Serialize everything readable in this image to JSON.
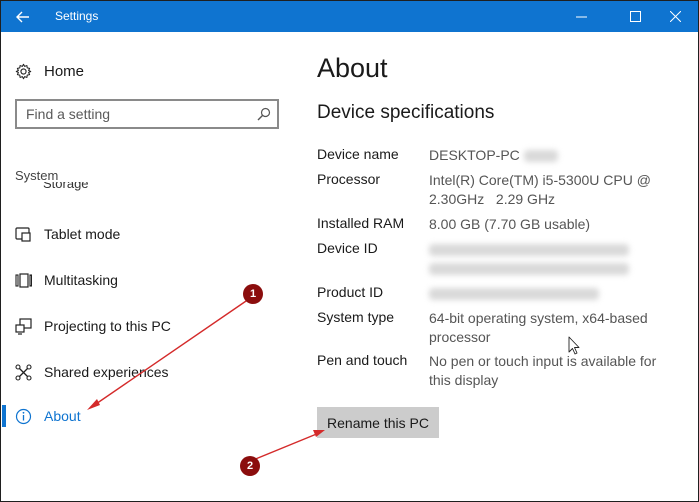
{
  "window": {
    "title": "Settings",
    "back_icon": "arrow-left-icon",
    "controls": [
      "minimize-icon",
      "maximize-icon",
      "close-icon"
    ]
  },
  "sidebar": {
    "home_label": "Home",
    "search_placeholder": "Find a setting",
    "section_label": "System",
    "partial_item": "Storage",
    "items": [
      {
        "label": "Tablet mode",
        "icon": "tablet-mode-icon"
      },
      {
        "label": "Multitasking",
        "icon": "multitasking-icon"
      },
      {
        "label": "Projecting to this PC",
        "icon": "projecting-icon"
      },
      {
        "label": "Shared experiences",
        "icon": "shared-experiences-icon"
      },
      {
        "label": "About",
        "icon": "info-icon",
        "selected": true
      }
    ]
  },
  "main": {
    "title": "About",
    "section_heading": "Device specifications",
    "specs": [
      {
        "label": "Device name",
        "value": "DESKTOP-PC"
      },
      {
        "label": "Processor",
        "value": "Intel(R) Core(TM) i5-5300U CPU @ 2.30GHz   2.29 GHz"
      },
      {
        "label": "Installed RAM",
        "value": "8.00 GB (7.70 GB usable)"
      },
      {
        "label": "Device ID",
        "value": ""
      },
      {
        "label": "Product ID",
        "value": ""
      },
      {
        "label": "System type",
        "value": "64-bit operating system, x64-based processor"
      },
      {
        "label": "Pen and touch",
        "value": "No pen or touch input is available for this display"
      }
    ],
    "rename_button": "Rename this PC"
  },
  "annotations": {
    "badge_1": "1",
    "badge_2": "2",
    "arrow_color": "#d42a2a",
    "badge_color": "#8b0d0d"
  },
  "colors": {
    "accent": "#0f74d0",
    "button_bg": "#cccccc"
  }
}
